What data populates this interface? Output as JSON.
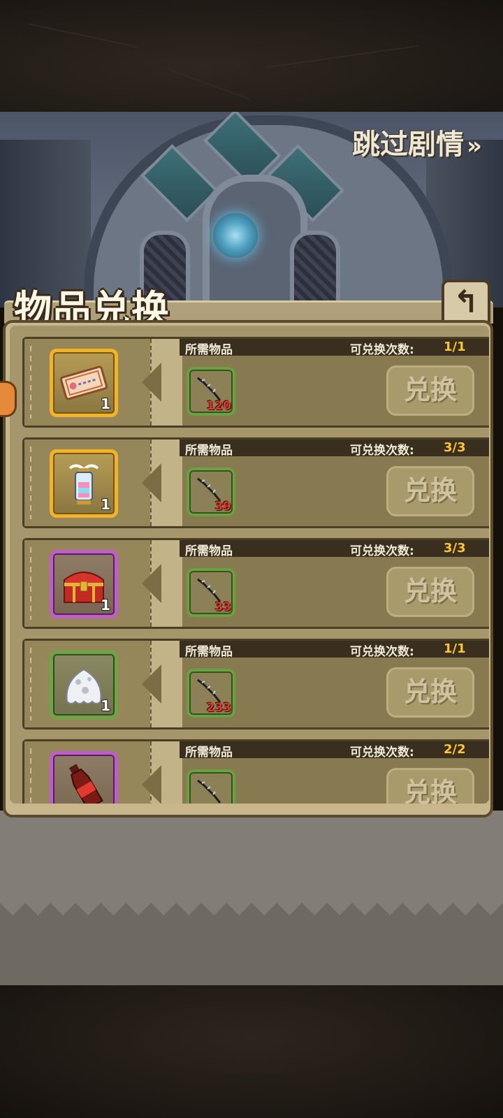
{
  "header": {
    "skip_story_label": "跳过剧情",
    "skip_story_chevron": "»"
  },
  "panel": {
    "title": "物品兑换",
    "back_icon": "↰"
  },
  "labels": {
    "required_items": "所需物品",
    "exchange_count": "可兑换次数:",
    "exchange_button": "兑换"
  },
  "rows": [
    {
      "reward_icon": "ticket-icon",
      "reward_qty": "1",
      "rarity": "gold",
      "required_icon": "shard-icon",
      "required_qty": "120",
      "count": "1/1"
    },
    {
      "reward_icon": "lantern-icon",
      "reward_qty": "1",
      "rarity": "gold",
      "required_icon": "shard-icon",
      "required_qty": "39",
      "count": "3/3"
    },
    {
      "reward_icon": "treasure-chest-icon",
      "reward_qty": "1",
      "rarity": "purple",
      "required_icon": "shard-icon",
      "required_qty": "33",
      "count": "3/3"
    },
    {
      "reward_icon": "slime-icon",
      "reward_qty": "1",
      "rarity": "green",
      "required_icon": "shard-icon",
      "required_qty": "233",
      "count": "1/1"
    },
    {
      "reward_icon": "bottle-icon",
      "reward_qty": "",
      "rarity": "purple",
      "required_icon": "shard-icon",
      "required_qty": "",
      "count": "2/2"
    }
  ],
  "colors": {
    "count_value": "#ffc52e",
    "required_qty": "#e8332b",
    "gold_frame": "#f1b32a",
    "purple_frame": "#c05ec7",
    "green_frame": "#6fa446"
  }
}
